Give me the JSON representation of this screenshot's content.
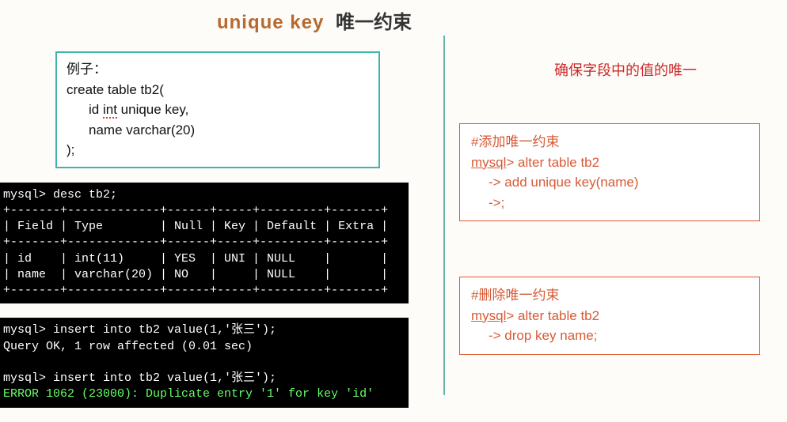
{
  "title": {
    "en": "unique key",
    "zh": "唯一约束"
  },
  "example": {
    "line1": "例子：",
    "line2": "create table tb2(",
    "field1_pre": "id ",
    "field1_sq": "int",
    "field1_post": " unique key,",
    "field2": "name varchar(20)",
    "close": ");"
  },
  "terminal1": "mysql> desc tb2;\n+-------+-------------+------+-----+---------+-------+\n| Field | Type        | Null | Key | Default | Extra |\n+-------+-------------+------+-----+---------+-------+\n| id    | int(11)     | YES  | UNI | NULL    |       |\n| name  | varchar(20) | NO   |     | NULL    |       |\n+-------+-------------+------+-----+---------+-------+",
  "terminal2_l1": "mysql> insert into tb2 value(1,'张三');",
  "terminal2_l2": "Query OK, 1 row affected (0.01 sec)",
  "terminal2_blank": "",
  "terminal2_l3": "mysql> insert into tb2 value(1,'张三');",
  "terminal2_l4": "ERROR 1062 (23000): Duplicate entry '1' for key 'id'",
  "note": "确保字段中的值的唯一",
  "addBox": {
    "comment": "#添加唯一约束",
    "prompt": "mysql",
    "l1": "> alter table tb2",
    "l2": "-> add unique key(name)",
    "l3": "->;"
  },
  "dropBox": {
    "comment": "#删除唯一约束",
    "prompt": "mysql",
    "l1": "> alter table tb2",
    "l2": "-> drop key name;"
  }
}
